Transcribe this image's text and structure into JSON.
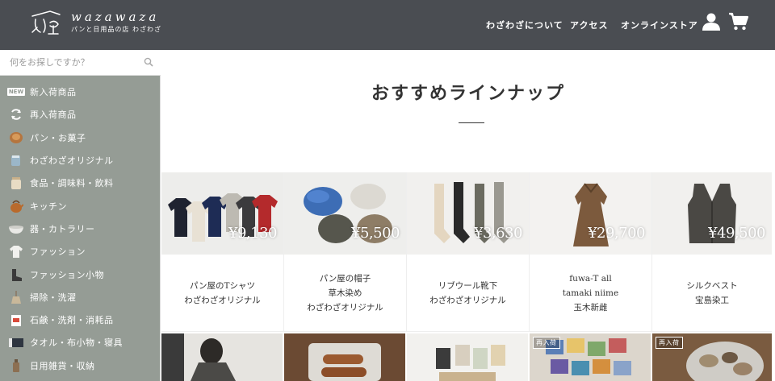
{
  "header": {
    "logo_text": "wazawaza",
    "logo_sub": "パンと日用品の店 わざわざ",
    "nav": [
      "わざわざについて",
      "アクセス",
      "オンラインストア"
    ],
    "icons": [
      "user-icon",
      "cart-icon"
    ],
    "bg_color": "#4a4d52"
  },
  "sidebar": {
    "search_placeholder": "何をお探しですか？",
    "bg_color": "#959c95",
    "categories": [
      {
        "label": "新入荷商品",
        "icon": "new-badge-icon",
        "badge": "NEW"
      },
      {
        "label": "再入荷商品",
        "icon": "refresh-icon"
      },
      {
        "label": "パン・お菓子",
        "icon": "bread-icon"
      },
      {
        "label": "わざわざオリジナル",
        "icon": "mug-icon"
      },
      {
        "label": "食品・調味料・飲料",
        "icon": "jar-icon"
      },
      {
        "label": "キッチン",
        "icon": "kettle-icon"
      },
      {
        "label": "器・カトラリー",
        "icon": "bowl-icon"
      },
      {
        "label": "ファッション",
        "icon": "shirt-icon"
      },
      {
        "label": "ファッション小物",
        "icon": "boots-icon"
      },
      {
        "label": "掃除・洗濯",
        "icon": "broom-icon"
      },
      {
        "label": "石鹸・洗剤・消耗品",
        "icon": "soap-icon"
      },
      {
        "label": "タオル・布小物・寝具",
        "icon": "towel-icon"
      },
      {
        "label": "日用雑貨・収納",
        "icon": "bottle-icon"
      }
    ]
  },
  "main": {
    "section_title": "おすすめラインナップ",
    "products": [
      {
        "price": "¥9,130",
        "lines": [
          "パン屋のTシャツ",
          "わざわざオリジナル"
        ],
        "image": "tshirts"
      },
      {
        "price": "¥5,500",
        "lines": [
          "パン屋の帽子",
          "草木染め",
          "わざわざオリジナル"
        ],
        "image": "hats"
      },
      {
        "price": "¥3,630",
        "lines": [
          "リブウール靴下",
          "わざわざオリジナル"
        ],
        "image": "socks"
      },
      {
        "price": "¥29,700",
        "lines": [
          "fuwa-T all",
          "tamaki niime",
          "玉木新雌"
        ],
        "image": "dress"
      },
      {
        "price": "¥49,500",
        "lines": [
          "シルクベスト",
          "宝島染工"
        ],
        "image": "vest"
      }
    ],
    "second_row": [
      {
        "image": "person",
        "badge": ""
      },
      {
        "image": "sausage-plate",
        "badge": ""
      },
      {
        "image": "packaged-food",
        "badge": ""
      },
      {
        "image": "tea-boxes",
        "badge": "再入荷"
      },
      {
        "image": "bread-plate",
        "badge": "再入荷"
      }
    ]
  }
}
